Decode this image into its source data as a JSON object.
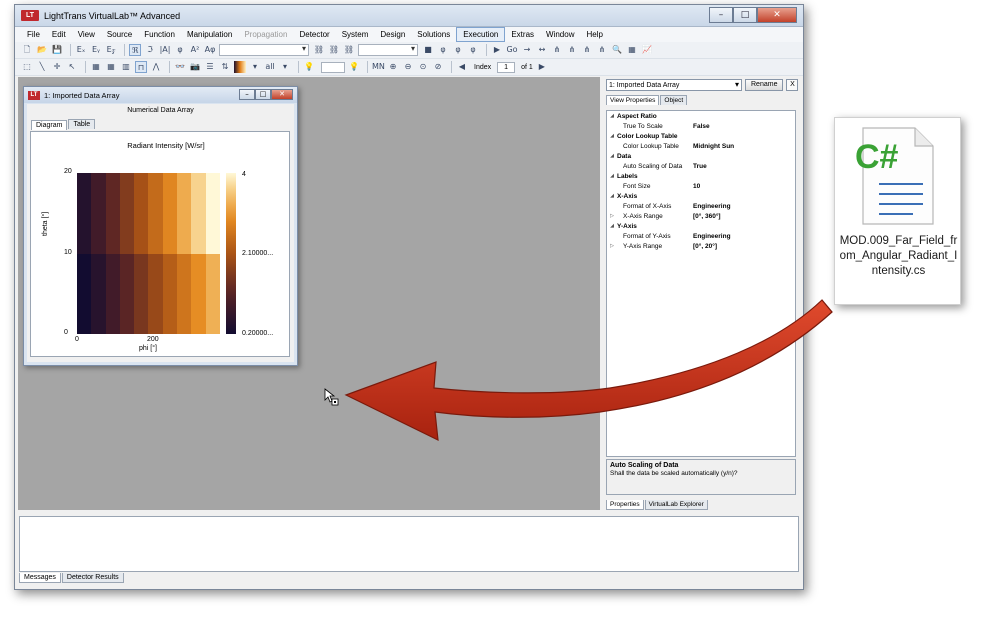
{
  "app": {
    "title": "LightTrans VirtualLab™ Advanced",
    "logo_text": "LT",
    "window_buttons": [
      "–",
      "□",
      "✕"
    ]
  },
  "menu": [
    "File",
    "Edit",
    "View",
    "Source",
    "Function",
    "Manipulation",
    "Propagation",
    "Detector",
    "System",
    "Design",
    "Solutions",
    "Execution",
    "Extras",
    "Window",
    "Help"
  ],
  "menu_disabled": [
    "Propagation"
  ],
  "menu_active": "Execution",
  "toolbar2": {
    "index_label": "Index",
    "index_value": "1",
    "of_label": "of 1"
  },
  "child_window": {
    "title": "1: Imported Data Array",
    "subtitle": "Numerical Data Array",
    "tabs": [
      "Diagram",
      "Table"
    ],
    "active_tab": "Diagram",
    "buttons": [
      "–",
      "□",
      "✕"
    ]
  },
  "chart_data": {
    "type": "heatmap",
    "title": "Radiant Intensity  [W/sr]",
    "xlabel": "phi [°]",
    "ylabel": "theta [°]",
    "xlim": [
      0,
      360
    ],
    "ylim": [
      0,
      20
    ],
    "x_ticks": [
      "0",
      "200"
    ],
    "y_ticks": [
      "0",
      "10",
      "20"
    ],
    "colormap": "Midnight Sun",
    "colorbar_ticks": [
      "4",
      "2.10000...",
      "0.20000..."
    ],
    "rows": [
      [
        0.45,
        0.85,
        1.25,
        1.65,
        2.05,
        2.45,
        2.85,
        3.25,
        3.65,
        4.0
      ],
      [
        0.2,
        0.5,
        0.85,
        1.2,
        1.55,
        1.9,
        2.25,
        2.6,
        2.95,
        3.3
      ]
    ],
    "vmin": 0.2,
    "vmax": 4
  },
  "dock": {
    "selector": "1: Imported Data Array",
    "rename_label": "Rename",
    "close_label": "X",
    "tabs": [
      "View Properties",
      "Object"
    ],
    "bottom_tabs": [
      "Properties",
      "VirtualLab Explorer"
    ],
    "properties": [
      {
        "cat": "Aspect Ratio"
      },
      {
        "name": "True To Scale",
        "value": "False"
      },
      {
        "cat": "Color Lookup Table"
      },
      {
        "name": "Color Lookup Table",
        "value": "Midnight Sun"
      },
      {
        "cat": "Data"
      },
      {
        "name": "Auto Scaling of Data",
        "value": "True"
      },
      {
        "cat": "Labels"
      },
      {
        "name": "Font Size",
        "value": "10"
      },
      {
        "cat": "X-Axis"
      },
      {
        "name": "Format of X-Axis",
        "value": "Engineering"
      },
      {
        "name": "X-Axis Range",
        "value": "[0°, 360°]",
        "expandable": true
      },
      {
        "cat": "Y-Axis"
      },
      {
        "name": "Format of Y-Axis",
        "value": "Engineering"
      },
      {
        "name": "Y-Axis Range",
        "value": "[0°, 20°]",
        "expandable": true
      }
    ],
    "description_title": "Auto Scaling of Data",
    "description_text": "Shall the data be scaled automatically (y/n)?"
  },
  "messages": {
    "tabs": [
      "Messages",
      "Detector Results"
    ]
  },
  "file": {
    "icon_letter": "C#",
    "name": "MOD.009_Far_Field_from_Angular_Radiant_Intensity.cs"
  },
  "colors": {
    "arrow": "#c8321e",
    "csharp_green": "#3aa235"
  }
}
